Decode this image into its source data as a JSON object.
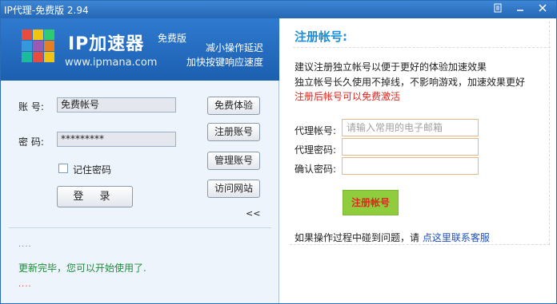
{
  "window": {
    "title": "IP代理-免费版 2.94",
    "controls": [
      "restore-icon",
      "minimize-icon",
      "close-icon"
    ]
  },
  "brand": {
    "name": "IP加速器",
    "site": "www.ipmana.com",
    "edition": "免费版",
    "slogan_line1": "减小操作延迟",
    "slogan_line2": "加快按键响应速度"
  },
  "login": {
    "account_label": "账 号:",
    "account_value": "免费帐号",
    "password_label": "密 码:",
    "password_value": "*********",
    "remember_label": "记住密码",
    "remember_checked": false,
    "login_button": "登 录"
  },
  "side_buttons": {
    "free_trial": "免费体验",
    "register": "注册账号",
    "manage": "管理账号",
    "visit": "访问网站",
    "collapse": "<<"
  },
  "log": {
    "dots_top": "....",
    "status": "更新完毕，您可以开始使用了.",
    "dots_bottom": "...."
  },
  "register": {
    "title": "注册帐号:",
    "desc1": "建议注册独立帐号以便于更好的体验加速效果",
    "desc2": "独立帐号长久使用不掉线，不影响游戏，加速效果更好",
    "desc3": "注册后帐号可以免费激活",
    "account_label": "代理帐号:",
    "account_placeholder": "请输入常用的电子邮箱",
    "password_label": "代理密码:",
    "confirm_label": "确认密码:",
    "submit": "注册帐号",
    "help_text": "如果操作过程中碰到问题，请",
    "help_link": "点这里联系客服"
  },
  "colors": {
    "titlebar": "#2567b4",
    "header": "#1c5fb0",
    "reg_title": "#1b8fd8",
    "red_text": "#e0261e",
    "green_button": "#8fcd3f",
    "status_green": "#1c8c3a",
    "link_blue": "#1c4fbf"
  }
}
